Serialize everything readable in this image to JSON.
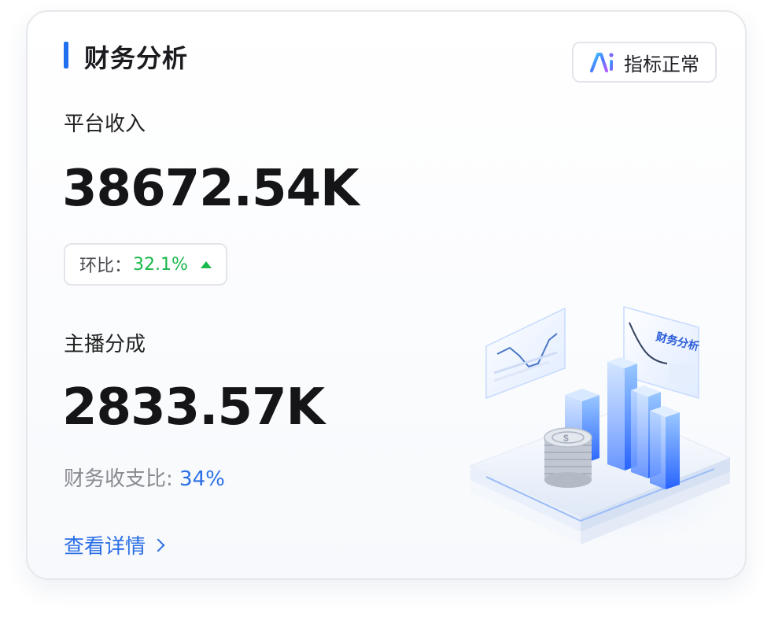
{
  "card": {
    "title": "财务分析",
    "badge_label": "指标正常",
    "platform_revenue": {
      "label": "平台收入",
      "value": "38672.54K",
      "mom_label": "环比：",
      "mom_value": "32.1%"
    },
    "anchor_share": {
      "label": "主播分成",
      "value": "2833.57K",
      "ratio_label": "财务收支比: ",
      "ratio_value": "34%"
    },
    "detail_link": "查看详情",
    "illustration_caption": "财务分析"
  },
  "colors": {
    "accent": "#1f6ff0",
    "positive": "#19b84a",
    "link": "#2b6fe6"
  },
  "icons": [
    "ai-logo-icon",
    "up-triangle-icon",
    "chevron-right-icon",
    "finance-illustration"
  ]
}
